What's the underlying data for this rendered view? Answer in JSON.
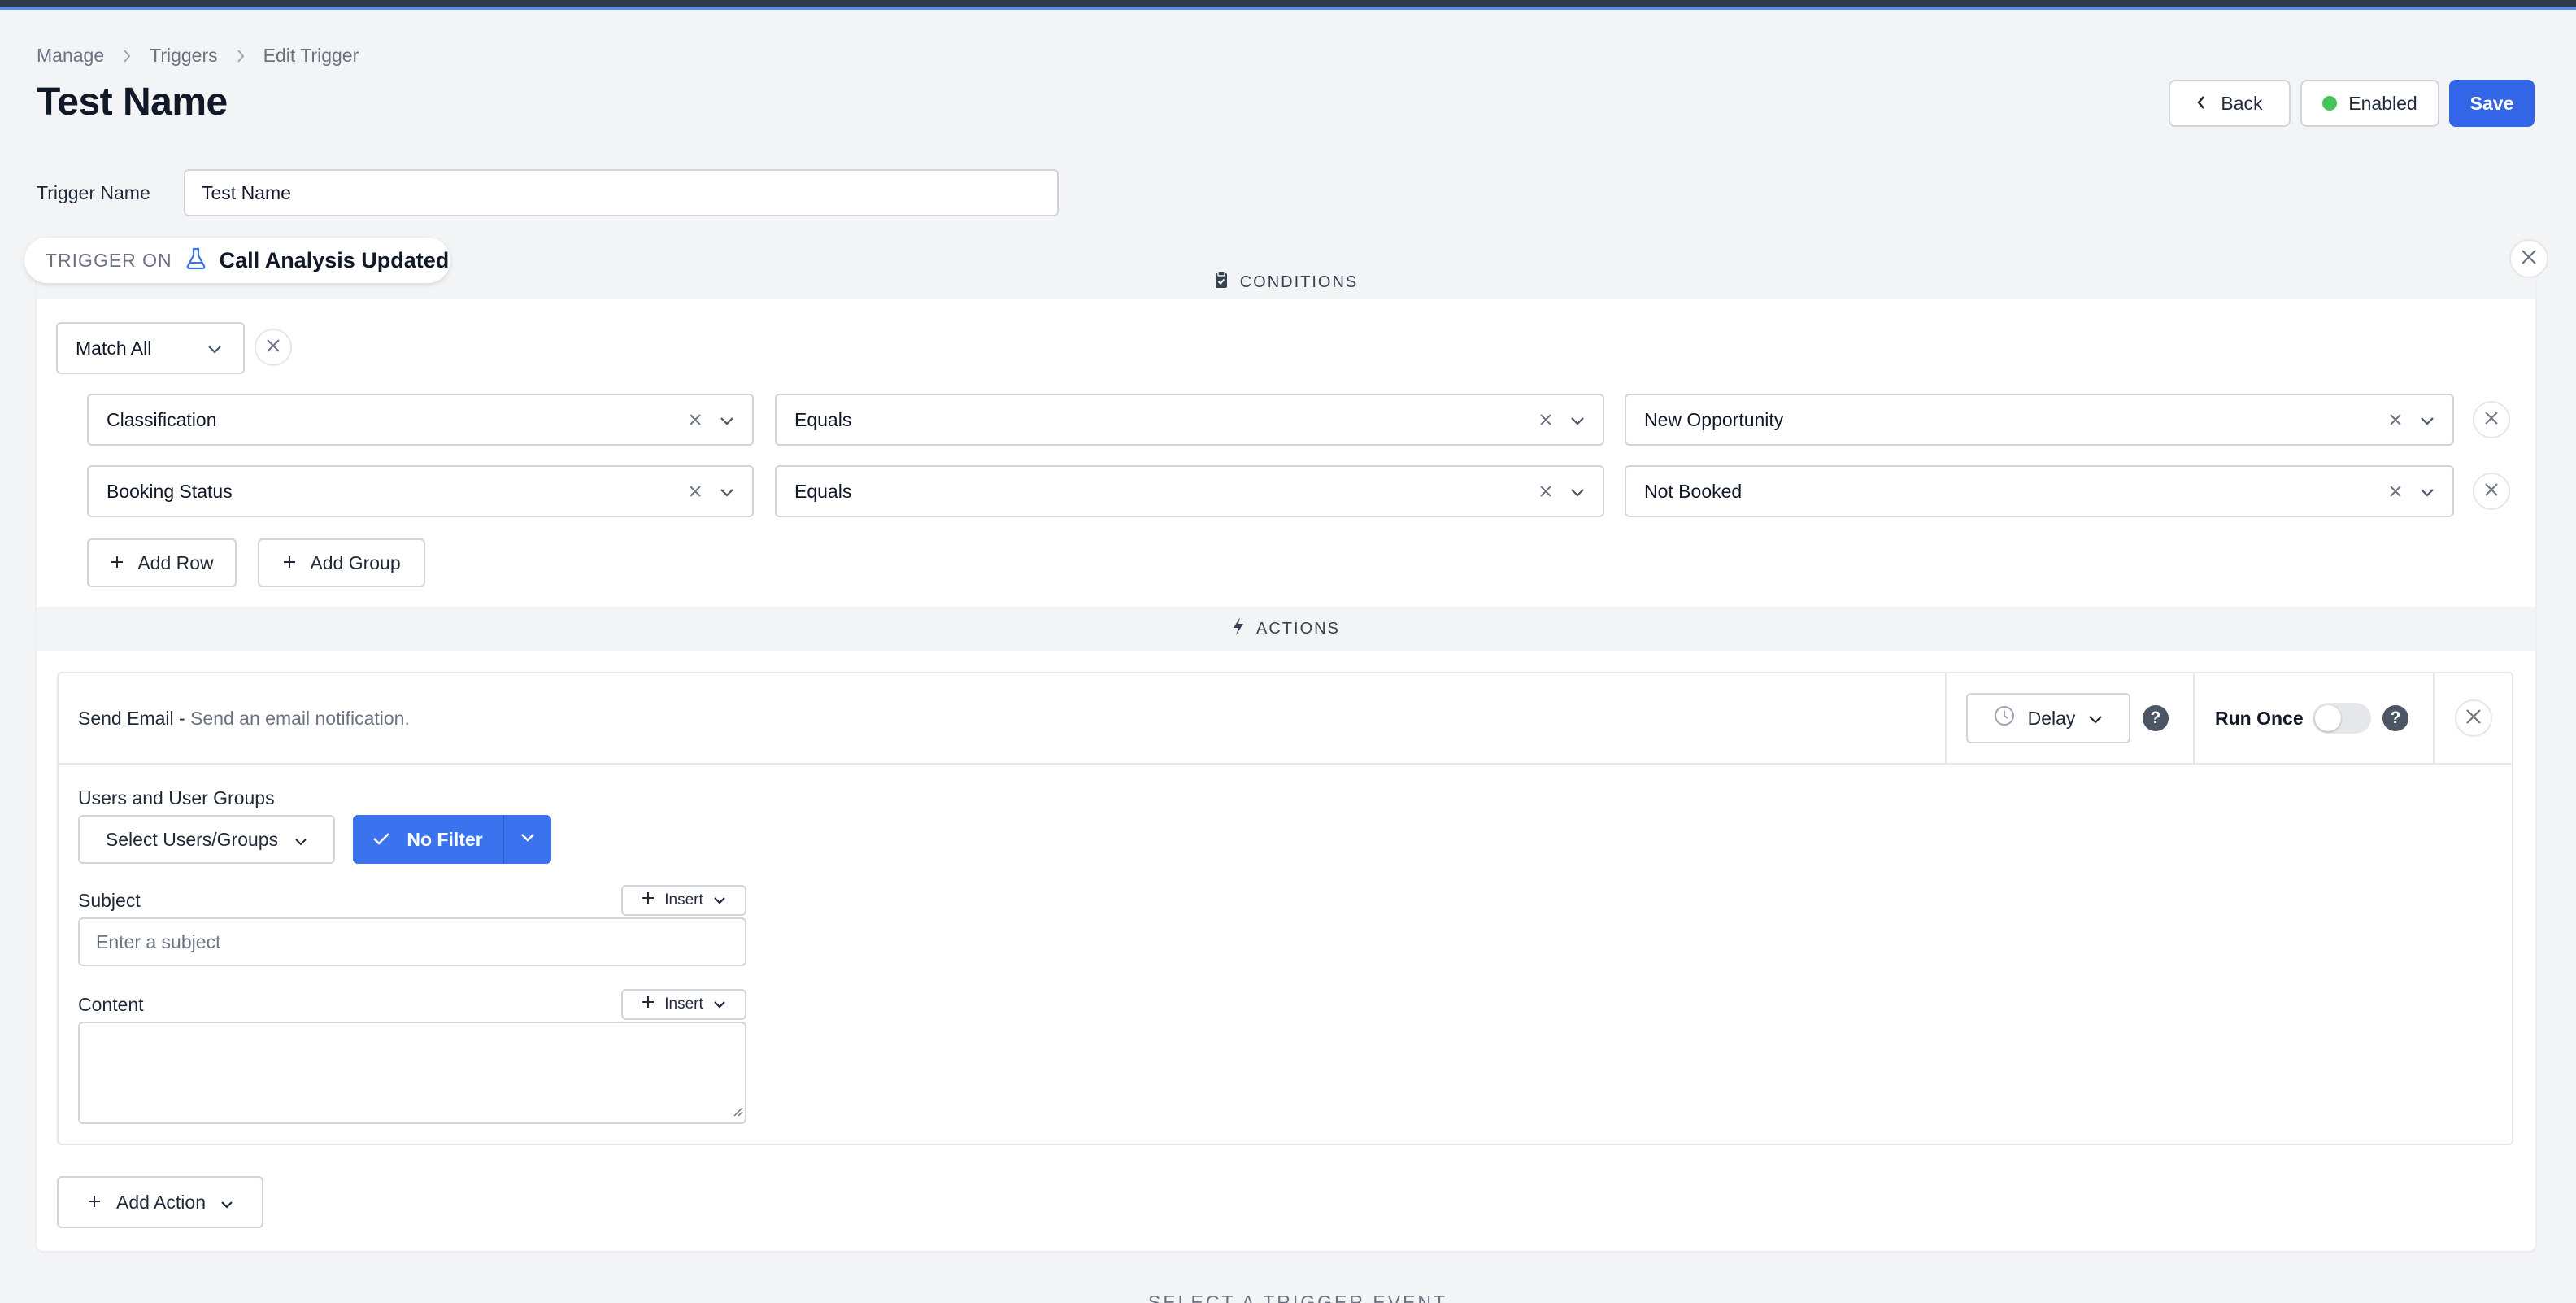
{
  "breadcrumb": {
    "items": [
      "Manage",
      "Triggers",
      "Edit Trigger"
    ]
  },
  "page": {
    "title": "Test Name"
  },
  "header": {
    "back_label": "Back",
    "status_label": "Enabled",
    "save_label": "Save",
    "status_color": "#44c45a",
    "accent": "#3366e6"
  },
  "trigger_name": {
    "label": "Trigger Name",
    "value": "Test Name"
  },
  "trigger_on": {
    "label": "TRIGGER ON",
    "event": "Call Analysis Updated",
    "icon": "flask-icon"
  },
  "conditions": {
    "header": "CONDITIONS",
    "match": "Match All",
    "rows": [
      {
        "field": "Classification",
        "operator": "Equals",
        "value": "New Opportunity"
      },
      {
        "field": "Booking Status",
        "operator": "Equals",
        "value": "Not Booked"
      }
    ],
    "add_row": "Add Row",
    "add_group": "Add Group"
  },
  "actions": {
    "header": "ACTIONS",
    "items": [
      {
        "name": "Send Email",
        "separator": " - ",
        "description": "Send an email notification.",
        "delay_label": "Delay",
        "run_once_label": "Run Once",
        "run_once": false,
        "users_label": "Users and User Groups",
        "users_placeholder": "Select Users/Groups",
        "filter_label": "No Filter",
        "subject_label": "Subject",
        "subject_placeholder": "Enter a subject",
        "content_label": "Content",
        "insert_label": "Insert"
      }
    ],
    "add_action": "Add Action"
  },
  "footer_hint": "SELECT A TRIGGER EVENT"
}
